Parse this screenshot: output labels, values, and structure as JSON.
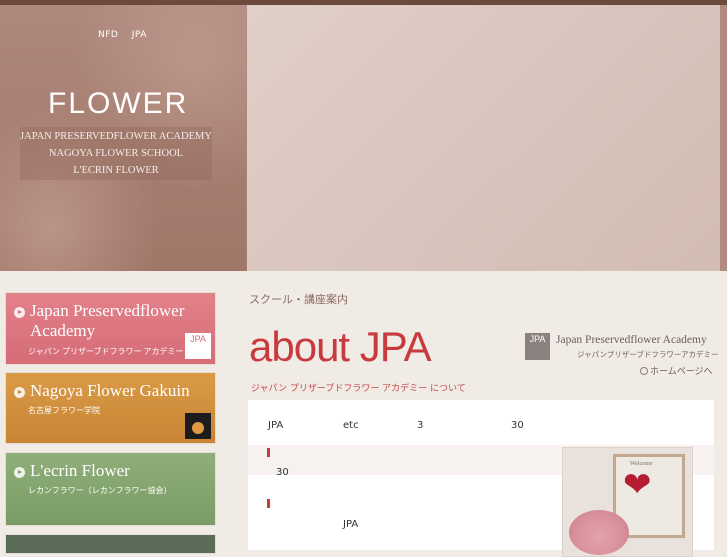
{
  "header": {
    "nav_links": [
      "NFD",
      "JPA"
    ],
    "logo": "FLOWER",
    "school_lines": [
      "JAPAN PRESERVEDFLOWER ACADEMY",
      "NAGOYA FLOWER SCHOOL",
      "L'ECRIN FLOWER"
    ]
  },
  "sidebar": {
    "banners": [
      {
        "title_line1": "Japan Preservedflower",
        "title_line2": "Academy",
        "subtitle": "ジャパン プリザーブドフラワー アカデミー",
        "mark": "JPA",
        "color": "#d56c78"
      },
      {
        "title_line1": "Nagoya Flower Gakuin",
        "subtitle": "名古屋フラワー学院",
        "color": "#c98534"
      },
      {
        "title_line1": "L'ecrin Flower",
        "subtitle": "レカンフラワー（レカンフラワー協会）",
        "color": "#7b9c66"
      }
    ]
  },
  "main": {
    "breadcrumb": "スクール・講座案内",
    "title": "about JPA",
    "subtitle": "ジャパン プリザーブドフラワー アカデミー について",
    "academy_logo": {
      "mark": "JPA",
      "name": "Japan Preservedflower Academy",
      "kana": "ジャパンプリザーブドフラワーアカデミー"
    },
    "home_link": "ホームページへ",
    "body": {
      "row1": [
        "JPA",
        "etc",
        "3",
        "30"
      ],
      "row2": "30",
      "row3": "JPA"
    },
    "photo_caption": "Welcome"
  }
}
